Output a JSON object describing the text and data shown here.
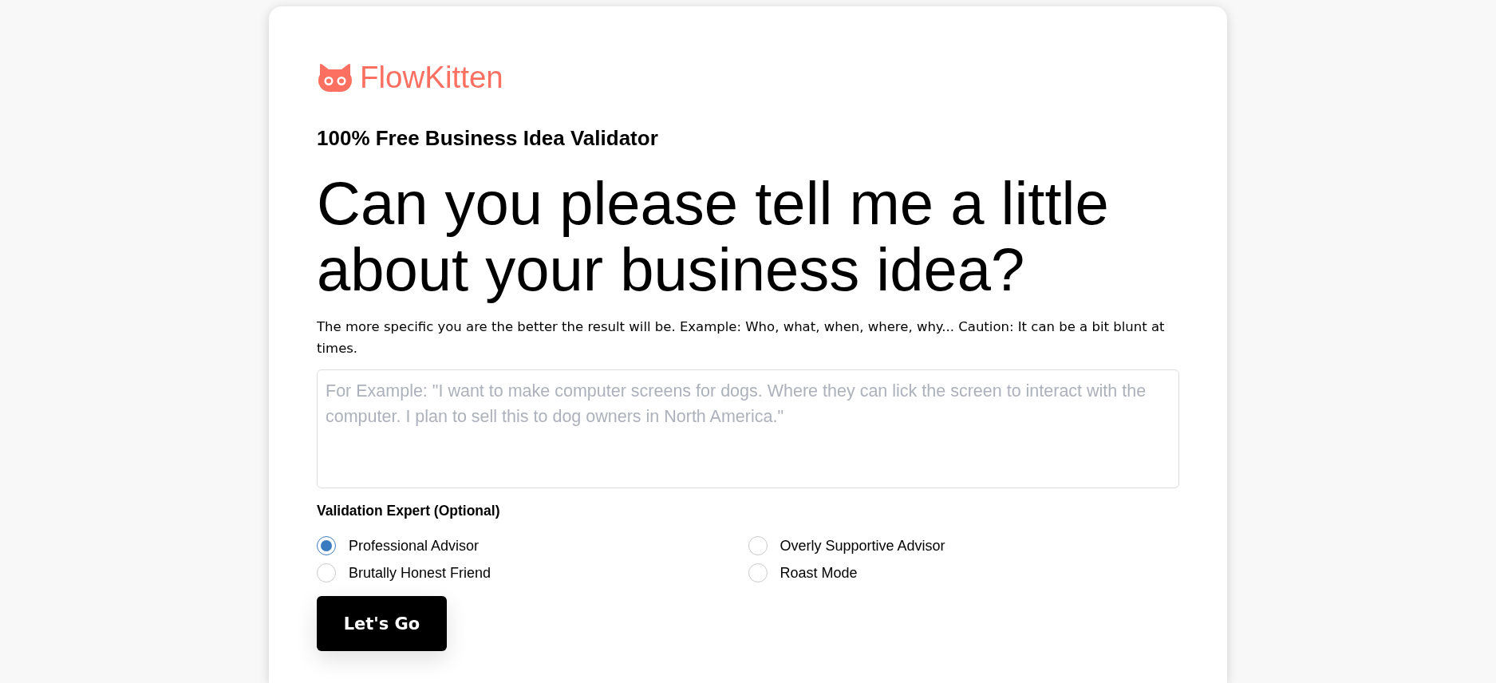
{
  "brand": {
    "name": "FlowKitten"
  },
  "tagline": "100% Free Business Idea Validator",
  "heading": "Can you please tell me a little about your business idea?",
  "description": "The more specific you are the better the result will be. Example: Who, what, when, where, why... Caution: It can be a bit blunt at times.",
  "idea_field": {
    "placeholder": "For Example: \"I want to make computer screens for dogs. Where they can lick the screen to interact with the computer. I plan to sell this to dog owners in North America.\""
  },
  "expert": {
    "label": "Validation Expert (Optional)",
    "options": [
      {
        "label": "Professional Advisor",
        "selected": true
      },
      {
        "label": "Overly Supportive Advisor",
        "selected": false
      },
      {
        "label": "Brutally Honest Friend",
        "selected": false
      },
      {
        "label": "Roast Mode",
        "selected": false
      }
    ]
  },
  "submit_button": {
    "label": "Let's Go"
  }
}
